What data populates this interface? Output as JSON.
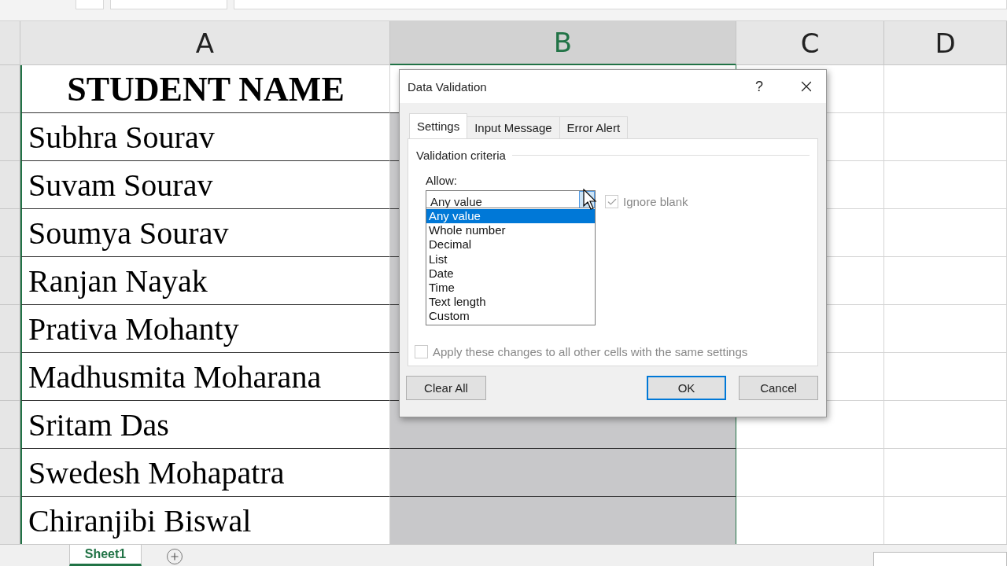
{
  "columns": [
    {
      "label": "A",
      "selected": false
    },
    {
      "label": "B",
      "selected": true
    },
    {
      "label": "C",
      "selected": false
    },
    {
      "label": "D",
      "selected": false
    }
  ],
  "header_cell": "STUDENT NAME",
  "rows": [
    {
      "name": "Subhra Sourav",
      "selected": true
    },
    {
      "name": "Suvam Sourav",
      "selected": true
    },
    {
      "name": "Soumya Sourav",
      "selected": true
    },
    {
      "name": "Ranjan Nayak",
      "selected": true
    },
    {
      "name": "Prativa Mohanty",
      "selected": true
    },
    {
      "name": "Madhusmita Moharana",
      "selected": true
    },
    {
      "name": "Sritam Das",
      "selected": true
    },
    {
      "name": "Swedesh Mohapatra",
      "selected": true
    },
    {
      "name": "Chiranjibi Biswal",
      "selected": true
    }
  ],
  "dialog": {
    "title": "Data Validation",
    "help": "?",
    "tabs": [
      {
        "label": "Settings",
        "selected": true
      },
      {
        "label": "Input Message",
        "selected": false
      },
      {
        "label": "Error Alert",
        "selected": false
      }
    ],
    "section": "Validation criteria",
    "allow_label": "Allow:",
    "allow_value": "Any value",
    "options": [
      {
        "label": "Any value",
        "selected": true
      },
      {
        "label": "Whole number",
        "selected": false
      },
      {
        "label": "Decimal",
        "selected": false
      },
      {
        "label": "List",
        "selected": false
      },
      {
        "label": "Date",
        "selected": false
      },
      {
        "label": "Time",
        "selected": false
      },
      {
        "label": "Text length",
        "selected": false
      },
      {
        "label": "Custom",
        "selected": false
      }
    ],
    "ignore_blank": {
      "label": "Ignore blank",
      "checked": true,
      "disabled": true
    },
    "apply_all": {
      "label": "Apply these changes to all other cells with the same settings",
      "checked": false,
      "disabled": true
    },
    "buttons": [
      {
        "label": "Clear All",
        "default": false
      },
      {
        "label": "OK",
        "default": true
      },
      {
        "label": "Cancel",
        "default": false
      }
    ]
  },
  "sheet_tabs": [
    {
      "label": "Sheet1",
      "selected": true
    }
  ]
}
